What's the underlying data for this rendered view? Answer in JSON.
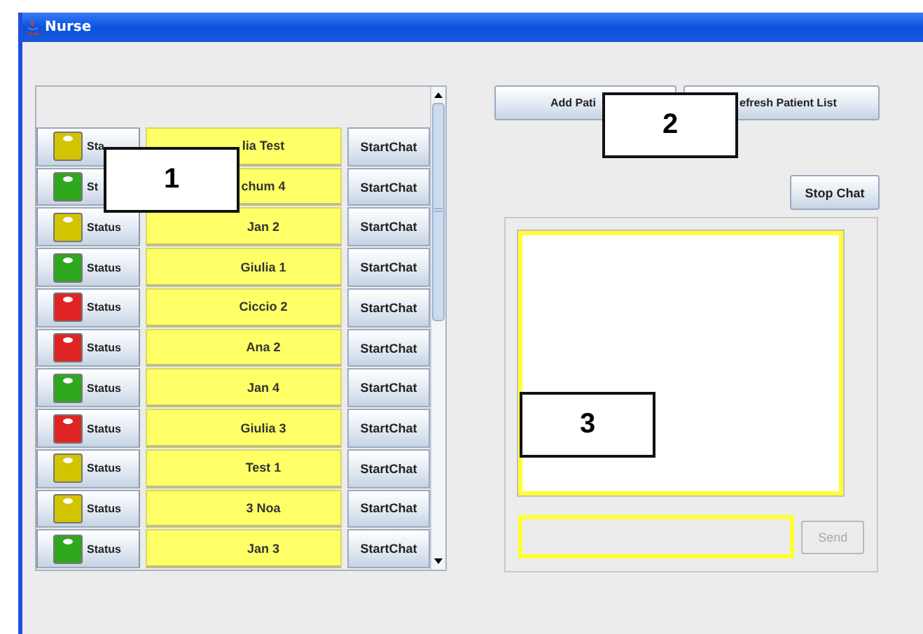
{
  "window": {
    "title": "Nurse"
  },
  "patients": [
    {
      "status_label": "Sta",
      "color": "#d2c400",
      "name": "lia Test",
      "chat_label": "StartChat"
    },
    {
      "status_label": "St",
      "color": "#2ea81c",
      "name": "chum 4",
      "chat_label": "StartChat"
    },
    {
      "status_label": "Status",
      "color": "#d2c400",
      "name": "Jan 2",
      "chat_label": "StartChat"
    },
    {
      "status_label": "Status",
      "color": "#2ea81c",
      "name": "Giulia 1",
      "chat_label": "StartChat"
    },
    {
      "status_label": "Status",
      "color": "#e02424",
      "name": "Ciccio 2",
      "chat_label": "StartChat"
    },
    {
      "status_label": "Status",
      "color": "#e02424",
      "name": "Ana 2",
      "chat_label": "StartChat"
    },
    {
      "status_label": "Status",
      "color": "#2ea81c",
      "name": "Jan 4",
      "chat_label": "StartChat"
    },
    {
      "status_label": "Status",
      "color": "#e02424",
      "name": "Giulia 3",
      "chat_label": "StartChat"
    },
    {
      "status_label": "Status",
      "color": "#d2c400",
      "name": "Test 1",
      "chat_label": "StartChat"
    },
    {
      "status_label": "Status",
      "color": "#d2c400",
      "name": "3 Noa",
      "chat_label": "StartChat"
    },
    {
      "status_label": "Status",
      "color": "#2ea81c",
      "name": "Jan 3",
      "chat_label": "StartChat"
    }
  ],
  "top_buttons": [
    {
      "label": "Add Pati"
    },
    {
      "label": "efresh Patient List"
    }
  ],
  "stop_chat": {
    "label": "Stop Chat"
  },
  "chat": {
    "send": {
      "label": "Send",
      "disabled": true
    }
  },
  "callouts": [
    {
      "label": "1"
    },
    {
      "label": "2"
    },
    {
      "label": "3"
    }
  ]
}
